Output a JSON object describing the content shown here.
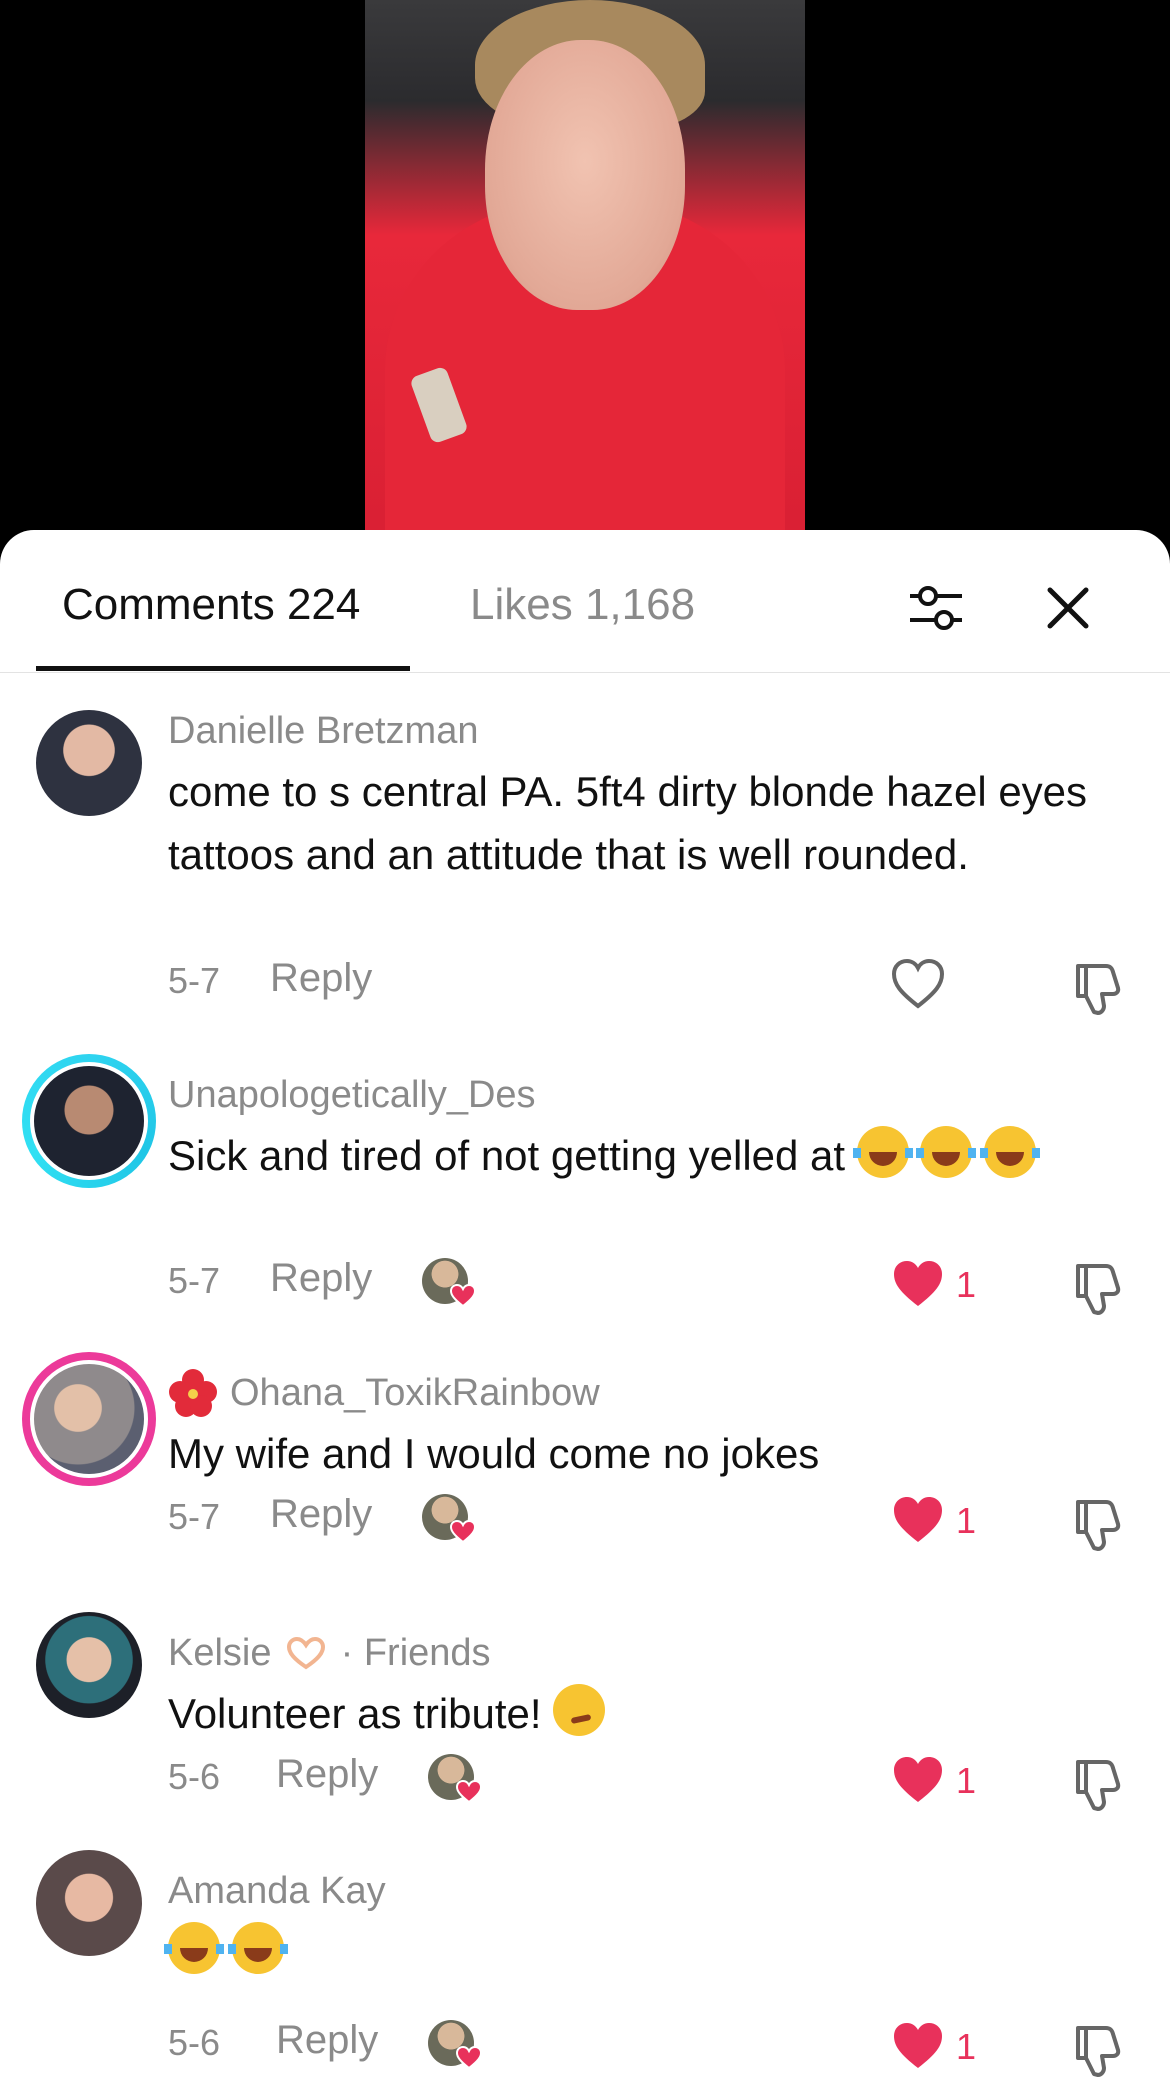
{
  "header": {
    "comments_label": "Comments 224",
    "likes_label": "Likes 1,168",
    "filter_icon": "sliders-icon",
    "close_icon": "close-icon"
  },
  "colors": {
    "accent_like": "#e8315b",
    "muted_text": "#8a8a8a",
    "story_ring_blue": "#2fd4f0",
    "story_ring_pink": "#ec3a9a"
  },
  "comments": [
    {
      "name": "Danielle Bretzman",
      "text": "come to s central PA. 5ft4 dirty blonde hazel eyes tattoos and an attitude that is well rounded.",
      "date": "5-7",
      "reply": "Reply",
      "likes": ""
    },
    {
      "name": "Unapologetically_Des",
      "text": "Sick and tired of not getting yelled at",
      "date": "5-7",
      "reply": "Reply",
      "likes": "1"
    },
    {
      "name": "Ohana_ToxikRainbow",
      "text": "My wife and I would come no jokes",
      "date": "5-7",
      "reply": "Reply",
      "likes": "1"
    },
    {
      "name": "Kelsie",
      "name_suffix": "· Friends",
      "text": "Volunteer as tribute!",
      "date": "5-6",
      "reply": "Reply",
      "likes": "1"
    },
    {
      "name": "Amanda Kay",
      "text": "",
      "date": "5-6",
      "reply": "Reply",
      "likes": "1"
    }
  ]
}
